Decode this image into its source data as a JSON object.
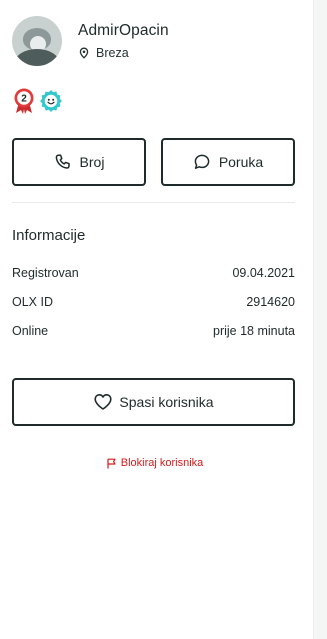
{
  "user": {
    "name": "AdmirOpacin",
    "location": "Breza",
    "avatar_icon": "user-avatar-placeholder",
    "badges": [
      {
        "icon": "rank-2-ribbon-badge",
        "label": "2",
        "color": "#e23b3b"
      },
      {
        "icon": "smiley-verified-badge",
        "color": "#33c8cf"
      }
    ]
  },
  "actions": {
    "call_label": "Broj",
    "call_icon": "phone-icon",
    "message_label": "Poruka",
    "message_icon": "chat-bubble-icon",
    "save_label": "Spasi korisnika",
    "save_icon": "heart-icon",
    "block_label": "Blokiraj korisnika",
    "block_icon": "flag-icon"
  },
  "info": {
    "title": "Informacije",
    "rows": [
      {
        "label": "Registrovan",
        "value": "09.04.2021"
      },
      {
        "label": "OLX ID",
        "value": "2914620"
      },
      {
        "label": "Online",
        "value": "prije 18 minuta"
      }
    ]
  },
  "colors": {
    "primary_dark": "#1f2a2a",
    "danger": "#d61a1a",
    "badge_red": "#e23b3b",
    "badge_teal": "#33c8cf"
  }
}
